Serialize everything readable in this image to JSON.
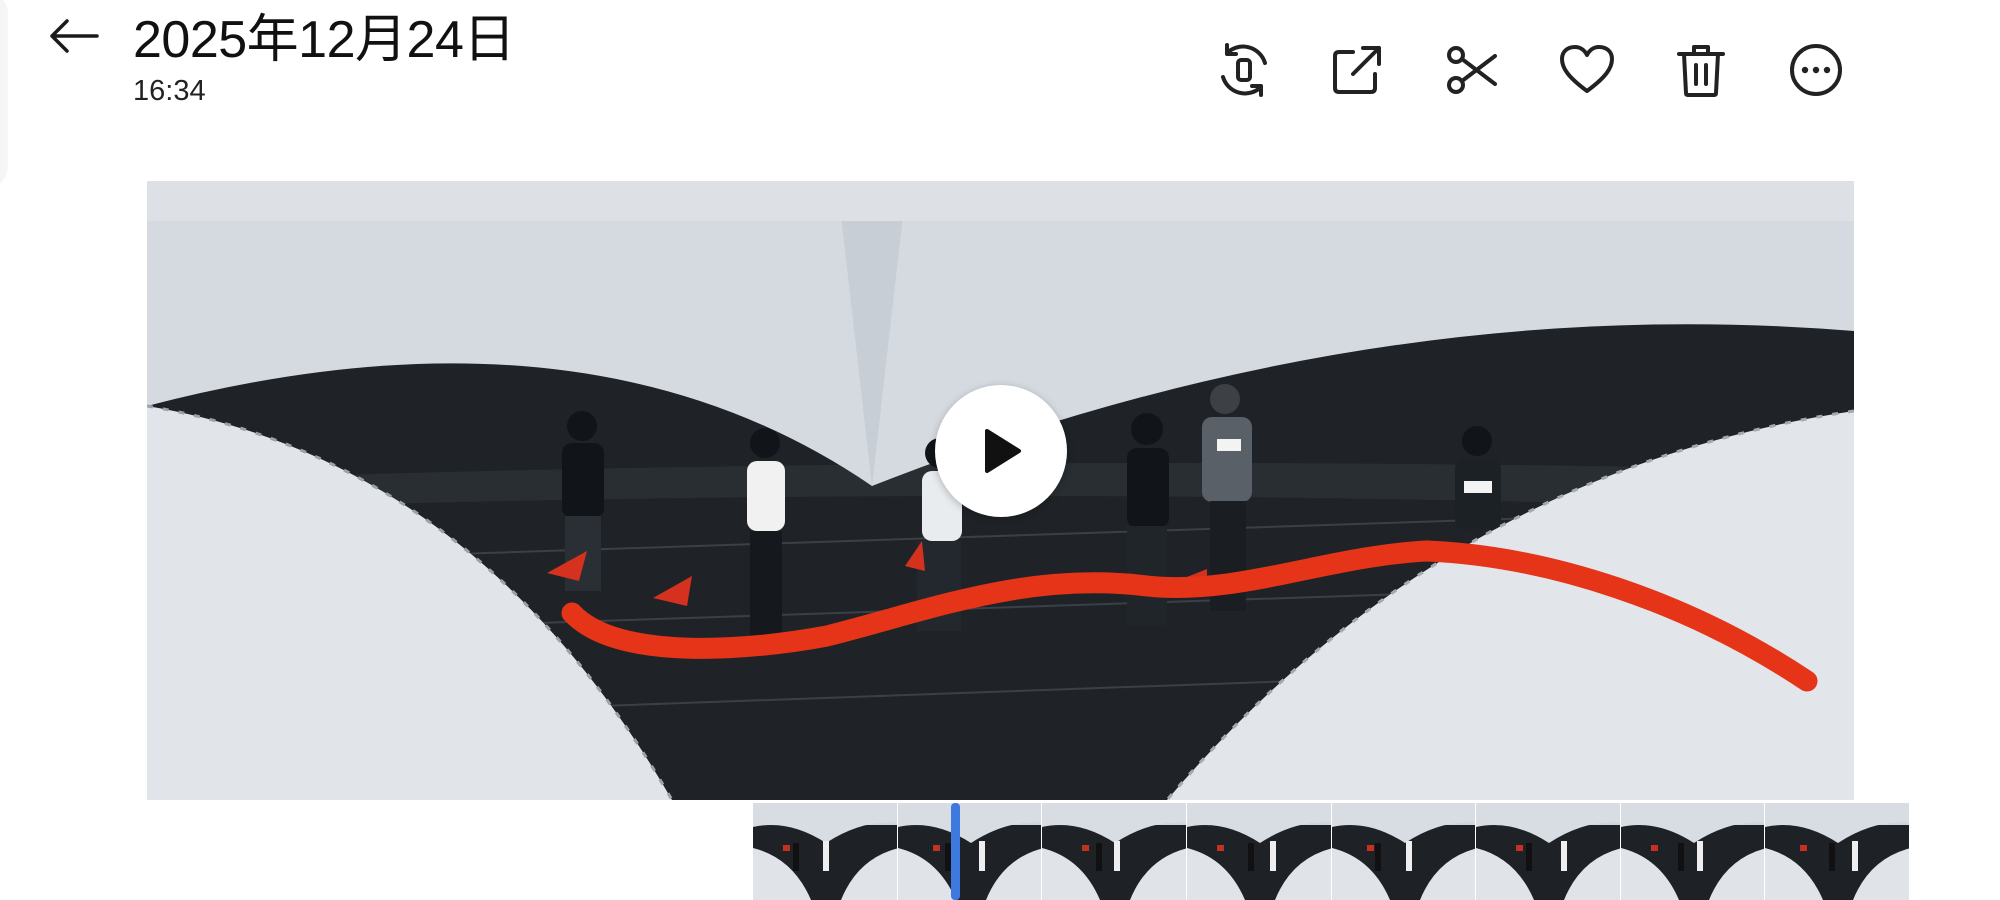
{
  "header": {
    "title": "2025年12月24日",
    "time": "16:34"
  },
  "toolbar": [
    {
      "name": "rotate-screen-icon",
      "label": "rotate"
    },
    {
      "name": "share-icon",
      "label": "share"
    },
    {
      "name": "scissors-icon",
      "label": "edit"
    },
    {
      "name": "heart-icon",
      "label": "favorite"
    },
    {
      "name": "trash-icon",
      "label": "delete"
    },
    {
      "name": "more-icon",
      "label": "more"
    }
  ],
  "video": {
    "state": "paused",
    "annotation_color": "#e53417"
  },
  "filmstrip": {
    "thumbnail_count": 8,
    "playhead_position": 0.18,
    "playhead_color": "#3e79e0"
  },
  "colors": {
    "accent": "#3e79e0",
    "annotation": "#e53417",
    "icon": "#222222"
  }
}
